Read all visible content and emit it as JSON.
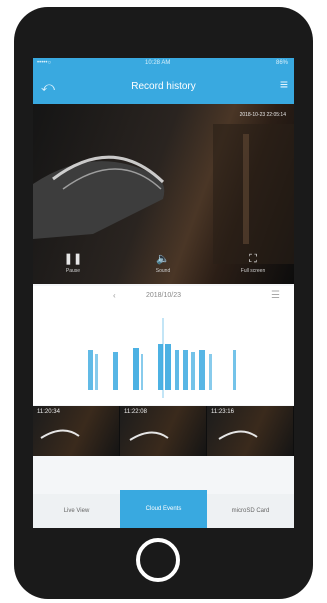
{
  "status_bar": {
    "left": "•••••○",
    "center": "10:28 AM",
    "right": "86%"
  },
  "nav": {
    "title": "Record history",
    "back_icon": "back-arrow-icon",
    "menu_icon": "more-icon"
  },
  "video": {
    "timestamp": "2018-10-23 22:05:14",
    "controls": [
      {
        "label": "Pause",
        "icon": "pause-icon"
      },
      {
        "label": "Sound",
        "icon": "speaker-icon"
      },
      {
        "label": "Full screen",
        "icon": "fullscreen-icon"
      }
    ]
  },
  "date_bar": {
    "date": "2018/10/23"
  },
  "thumbnails": [
    {
      "time": "11:20:34"
    },
    {
      "time": "11:22:08"
    },
    {
      "time": "11:23:16"
    }
  ],
  "tabs": [
    {
      "label": "Live View"
    },
    {
      "label": "Cloud Events"
    },
    {
      "label": "microSD Card"
    }
  ],
  "colors": {
    "accent": "#39a9e0",
    "phone": "#1a1a1a"
  }
}
